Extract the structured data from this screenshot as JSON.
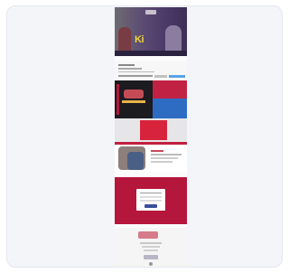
{
  "window": {
    "title": "",
    "hero_title": "Ki"
  },
  "colors": {
    "accent": "#b5163c",
    "link": "#5aa4e6",
    "hero": "#4b3a68"
  },
  "signup": {
    "label": ""
  },
  "promo": {
    "tag": ""
  }
}
